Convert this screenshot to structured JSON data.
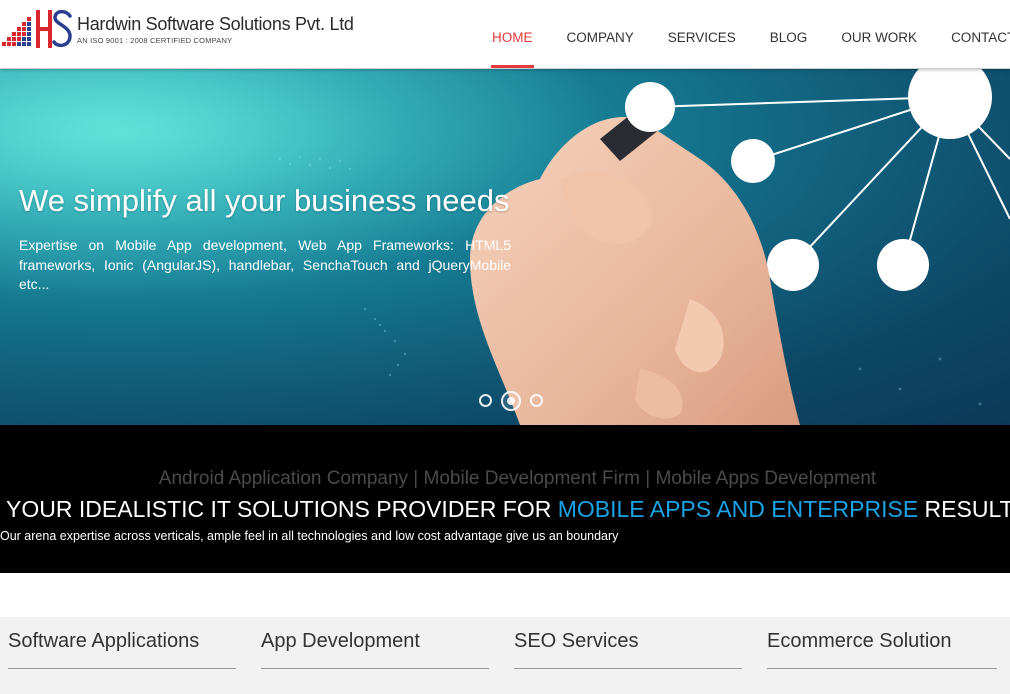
{
  "brand": {
    "name": "Hardwin Software Solutions Pvt. Ltd",
    "tagline": "AN ISO 9001 : 2008 CERTIFIED COMPANY",
    "logo_letters": "HS",
    "colors": {
      "accent_red": "#e23b3b",
      "logo_red": "#d9262f",
      "logo_blue": "#2a3f8f",
      "highlight_blue": "#1aa3e6"
    }
  },
  "nav": {
    "items": [
      {
        "label": "HOME",
        "active": true
      },
      {
        "label": "COMPANY",
        "active": false
      },
      {
        "label": "SERVICES",
        "active": false
      },
      {
        "label": "BLOG",
        "active": false
      },
      {
        "label": "OUR WORK",
        "active": false
      },
      {
        "label": "CONTACT U",
        "active": false
      }
    ]
  },
  "hero": {
    "title": "We simplify all your business needs",
    "text": "Expertise on Mobile App development, Web App Frameworks: HTML5 frameworks, Ionic (AngularJS), handlebar, SenchaTouch and jQueryMobile etc...",
    "slides_total": 3,
    "active_slide": 2
  },
  "band": {
    "subtitle": "Android Application Company | Mobile Development Firm | Mobile Apps Development",
    "headline_pre": "YOUR IDEALISTIC IT SOLUTIONS PROVIDER FOR ",
    "headline_highlight": "MOBILE APPS AND ENTERPRISE",
    "headline_post": " RESULTS",
    "description": "Our arena expertise across verticals, ample feel in all technologies and low cost advantage give us an boundary"
  },
  "services": {
    "items": [
      {
        "label": "Software Applications"
      },
      {
        "label": "App Development"
      },
      {
        "label": "SEO Services"
      },
      {
        "label": "Ecommerce Solution"
      }
    ]
  }
}
